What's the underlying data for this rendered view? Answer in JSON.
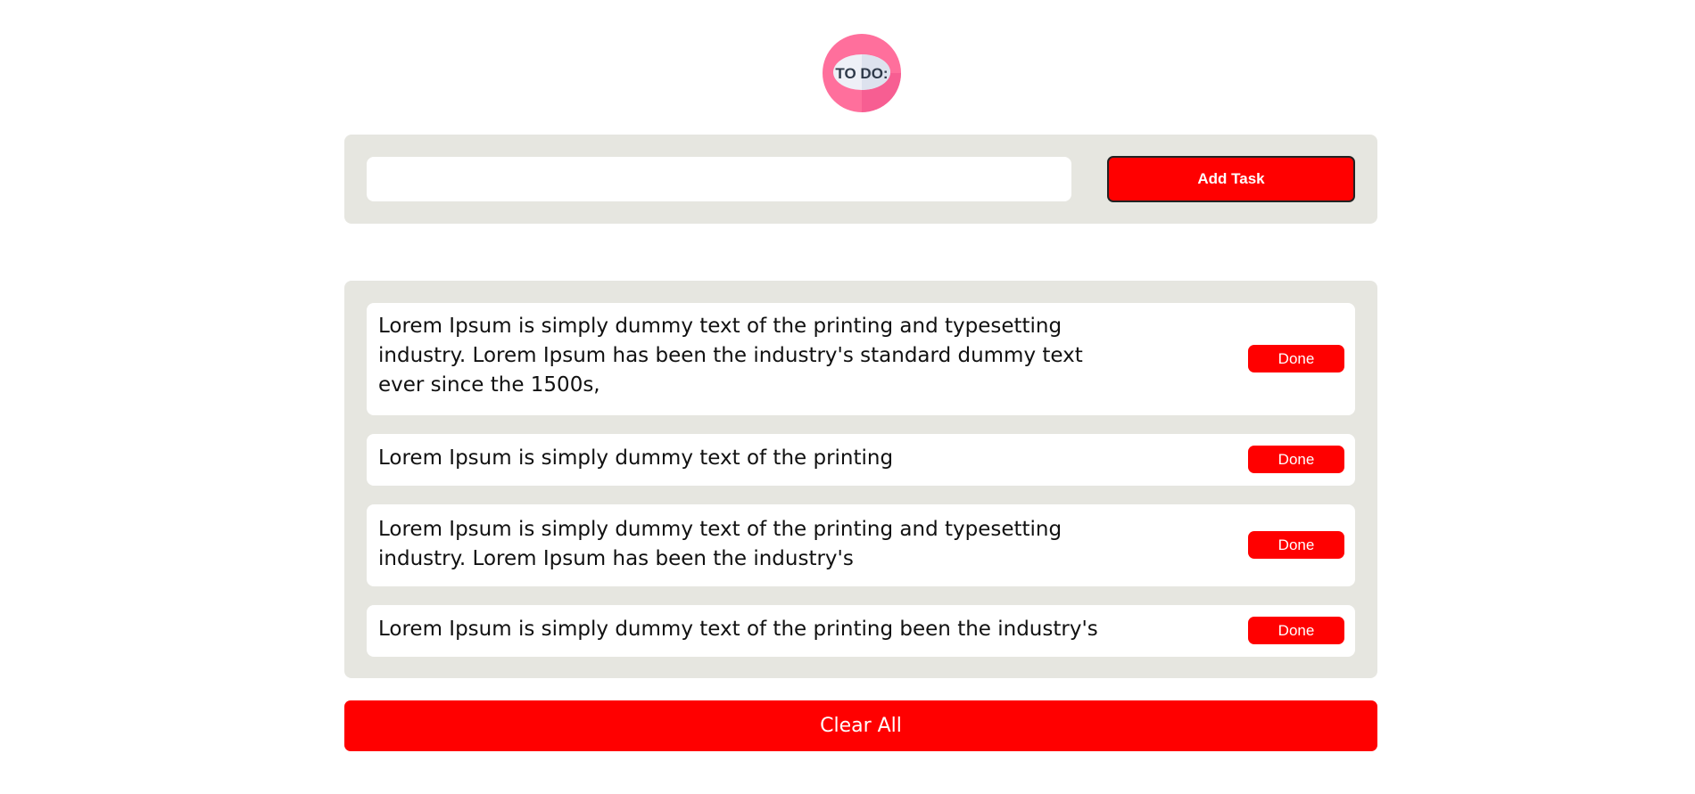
{
  "logo": {
    "text": "TO DO:",
    "colors": {
      "ring": "#ff6f9c",
      "inner": "#eef0f7",
      "text": "#2f3a4a"
    }
  },
  "add_task": {
    "input_value": "",
    "input_placeholder": "",
    "button_label": "Add Task"
  },
  "tasks": [
    {
      "text": "Lorem Ipsum is simply dummy text of the printing and typesetting industry. Lorem Ipsum has been the industry's standard dummy text ever since the 1500s,",
      "button_label": "Done"
    },
    {
      "text": "Lorem Ipsum is simply dummy text of the printing",
      "button_label": "Done"
    },
    {
      "text": "Lorem Ipsum is simply dummy text of the printing and typesetting industry. Lorem Ipsum has been the industry's",
      "button_label": "Done"
    },
    {
      "text": "Lorem Ipsum is simply dummy text of the printing been the industry's",
      "button_label": "Done"
    }
  ],
  "clear_all": {
    "label": "Clear All"
  },
  "colors": {
    "accent": "#ff0000",
    "panel_bg": "#e6e6e0",
    "item_bg": "#ffffff"
  }
}
